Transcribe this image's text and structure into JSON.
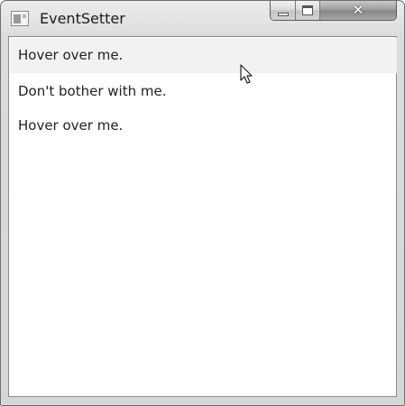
{
  "window": {
    "title": "EventSetter",
    "controls": {
      "minimize": "minimize",
      "maximize": "maximize",
      "close": "✕"
    }
  },
  "icons": {
    "app": "app-window-icon",
    "cursor": "mouse-pointer-icon"
  },
  "list": {
    "items": [
      {
        "label": "Hover over me.",
        "state": "hovered"
      },
      {
        "label": "Don't bother with me.",
        "state": "normal"
      },
      {
        "label": "Hover over me.",
        "state": "normal"
      }
    ]
  },
  "colors": {
    "hover_background": "#f2f2f2",
    "text": "#222222"
  }
}
